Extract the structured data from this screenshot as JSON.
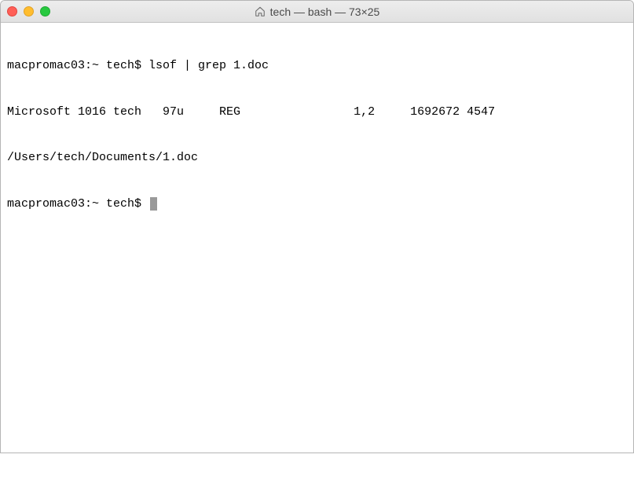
{
  "window": {
    "title": "tech — bash — 73×25"
  },
  "terminal": {
    "lines": [
      "macpromac03:~ tech$ lsof | grep 1.doc",
      "Microsoft 1016 tech   97u     REG                1,2     1692672 4547",
      "/Users/tech/Documents/1.doc",
      "macpromac03:~ tech$ "
    ]
  }
}
